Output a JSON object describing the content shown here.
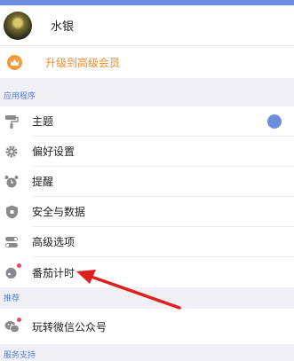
{
  "profile": {
    "name": "水银",
    "avatar": "avatar-image"
  },
  "upgrade": {
    "label": "升级到高级会员",
    "icon": "crown-icon"
  },
  "apps_section": {
    "title": "应用程序",
    "items": [
      {
        "label": "主题",
        "icon": "paint-roller-icon",
        "toggle": true
      },
      {
        "label": "偏好设置",
        "icon": "gear-icon"
      },
      {
        "label": "提醒",
        "icon": "alarm-clock-icon"
      },
      {
        "label": "安全与数据",
        "icon": "shield-icon"
      },
      {
        "label": "高级选项",
        "icon": "toggles-icon"
      },
      {
        "label": "番茄计时",
        "icon": "tomato-timer-icon",
        "badge": true
      }
    ]
  },
  "recommend_section": {
    "title": "推荐",
    "items": [
      {
        "label": "玩转微信公众号",
        "icon": "wechat-icon",
        "badge": true
      }
    ]
  },
  "support_section": {
    "title": "服务支持"
  },
  "colors": {
    "accent": "#6d8ee0",
    "orange": "#f28c28",
    "badge": "#e84a5f",
    "arrow": "#e0201e"
  }
}
